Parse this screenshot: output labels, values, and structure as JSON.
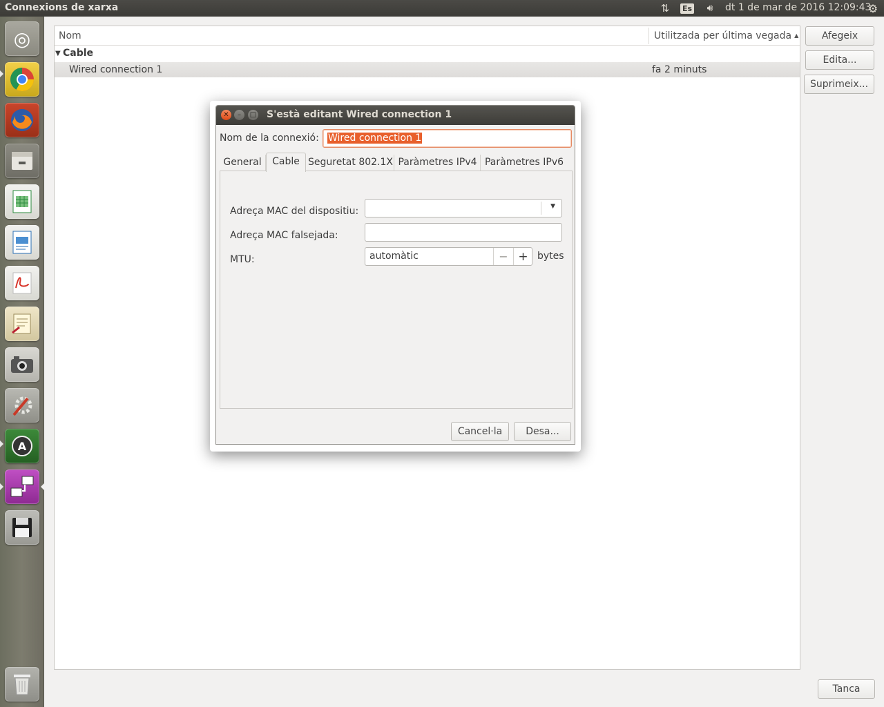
{
  "top_panel": {
    "window_title": "Connexions de xarxa",
    "network_icon": "network-updown-icon",
    "keyboard_layout": "Es",
    "volume_icon": "speaker-volume-icon",
    "clock": "dt  1 de mar de 2016 12:09:43",
    "system_icon": "gear-icon"
  },
  "launcher": {
    "items": [
      {
        "name": "ubuntu-dash",
        "icon": "ubuntu-logo-icon"
      },
      {
        "name": "chrome",
        "icon": "chrome-icon"
      },
      {
        "name": "firefox",
        "icon": "firefox-icon"
      },
      {
        "name": "files",
        "icon": "file-cabinet-icon"
      },
      {
        "name": "libreoffice-calc",
        "icon": "spreadsheet-icon"
      },
      {
        "name": "libreoffice-writer",
        "icon": "document-icon"
      },
      {
        "name": "document-viewer",
        "icon": "pdf-viewer-icon"
      },
      {
        "name": "wine-notepad",
        "icon": "notepad-icon"
      },
      {
        "name": "webcam",
        "icon": "camera-icon"
      },
      {
        "name": "system-settings",
        "icon": "tools-icon"
      },
      {
        "name": "software-updater",
        "icon": "software-updater-icon"
      },
      {
        "name": "network-connections",
        "icon": "network-connections-icon"
      },
      {
        "name": "save",
        "icon": "floppy-disk-icon"
      },
      {
        "name": "trash",
        "icon": "trash-icon"
      }
    ]
  },
  "main": {
    "columns": {
      "name": "Nom",
      "last_used": "Utilitzada per última vegada"
    },
    "groups": [
      {
        "label": "Cable",
        "connections": [
          {
            "name": "Wired connection 1",
            "last_used": "fa 2 minuts"
          }
        ]
      }
    ],
    "buttons": {
      "add": "Afegeix",
      "edit": "Edita...",
      "delete": "Suprimeix...",
      "close": "Tanca"
    }
  },
  "dialog": {
    "title": "S'està editant Wired connection 1",
    "connection_name_label": "Nom de la connexió:",
    "connection_name_value": "Wired connection 1",
    "tabs": [
      "General",
      "Cable",
      "Seguretat 802.1X",
      "Paràmetres IPv4",
      "Paràmetres IPv6"
    ],
    "active_tab": "Cable",
    "fields": {
      "device_mac_label": "Adreça MAC del dispositiu:",
      "device_mac_value": "",
      "cloned_mac_label": "Adreça MAC falsejada:",
      "cloned_mac_value": "",
      "mtu_label": "MTU:",
      "mtu_value": "automàtic",
      "mtu_unit": "bytes"
    },
    "buttons": {
      "cancel": "Cancel·la",
      "save": "Desa..."
    }
  },
  "colors": {
    "accent": "#e85f2b",
    "panel": "#3c3b37",
    "window_bg": "#f2f1f0",
    "launcher_bg": "#7d7c6e"
  }
}
